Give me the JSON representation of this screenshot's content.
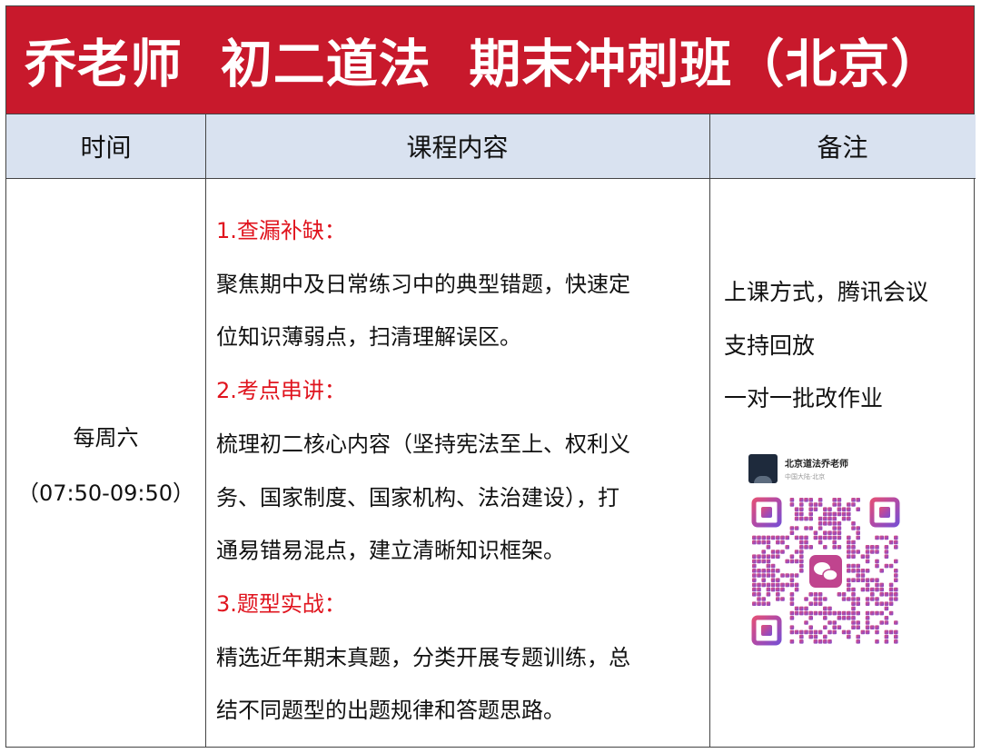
{
  "title": "乔老师  初二道法  期末冲刺班（北京）",
  "headers": {
    "time": "时间",
    "content": "课程内容",
    "notes": "备注"
  },
  "time": {
    "day": "每周六",
    "range": "（07:50-09:50）"
  },
  "content_lines": [
    {
      "text": "1.查漏补缺：",
      "heading": true
    },
    {
      "text": "聚焦期中及日常练习中的典型错题，快速定",
      "heading": false
    },
    {
      "text": "位知识薄弱点，扫清理解误区。",
      "heading": false
    },
    {
      "text": "2.考点串讲：",
      "heading": true
    },
    {
      "text": "梳理初二核心内容（坚持宪法至上、权利义",
      "heading": false
    },
    {
      "text": "务、国家制度、国家机构、法治建设），打",
      "heading": false
    },
    {
      "text": "通易错易混点，建立清晰知识框架。",
      "heading": false
    },
    {
      "text": "3.题型实战：",
      "heading": true
    },
    {
      "text": "精选近年期末真题，分类开展专题训练，总",
      "heading": false
    },
    {
      "text": "结不同题型的出题规律和答题思路。",
      "heading": false
    }
  ],
  "notes": [
    "上课方式，腾讯会议",
    "支持回放",
    "一对一批改作业"
  ],
  "wechat_card": {
    "name": "北京道法乔老师",
    "location": "中国大陆·北京"
  },
  "colors": {
    "banner": "#c8192c",
    "header_bg": "#d9e2f0",
    "heading_text": "#e0141e"
  },
  "icons": {
    "qr": "qr-code-icon",
    "wechat": "wechat-logo-icon"
  }
}
